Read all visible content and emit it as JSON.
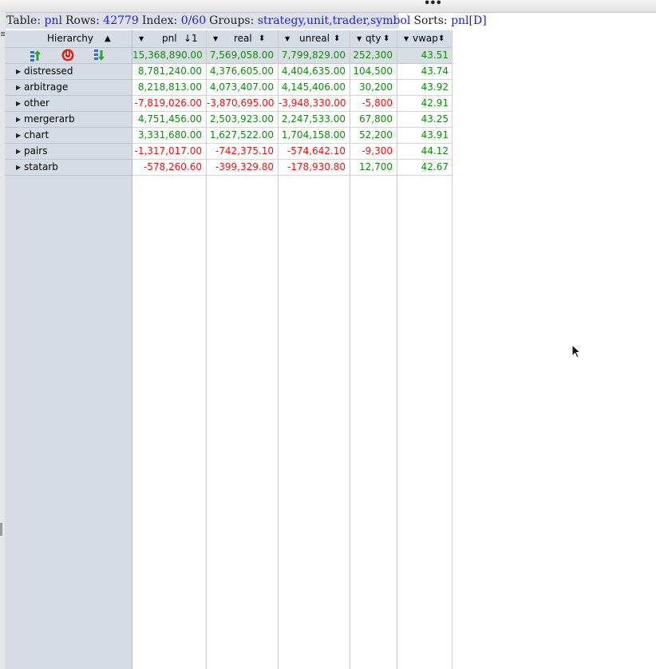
{
  "topbar": {
    "dots": "•••"
  },
  "left_edge": {
    "mark": "≡"
  },
  "info": {
    "table_key": "Table:",
    "table_val": "pnl",
    "rows_key": "Rows:",
    "rows_val": "42779",
    "index_key": "Index:",
    "index_val": "0/60",
    "groups_key": "Groups:",
    "groups_val": "strategy,unit,trader,symbol",
    "sorts_key": "Sorts:",
    "sorts_val": "pnl[D]"
  },
  "columns": {
    "hierarchy": "Hierarchy",
    "pnl": "pnl",
    "pnl_sort": "↓1",
    "real": "real",
    "unreal": "unreal",
    "qty": "qty",
    "vwap": "vwap"
  },
  "icons": {
    "expand": "expand-all-icon",
    "power": "power-icon",
    "collapse": "collapse-all-icon"
  },
  "totals": {
    "pnl": "15,368,890.00",
    "real": "7,569,058.00",
    "unreal": "7,799,829.00",
    "qty": "252,300",
    "vwap": "43.51"
  },
  "rows": [
    {
      "name": "distressed",
      "pnl": "8,781,240.00",
      "real": "4,376,605.00",
      "unreal": "4,404,635.00",
      "qty": "104,500",
      "vwap": "43.74"
    },
    {
      "name": "arbitrage",
      "pnl": "8,218,813.00",
      "real": "4,073,407.00",
      "unreal": "4,145,406.00",
      "qty": "30,200",
      "vwap": "43.92"
    },
    {
      "name": "other",
      "pnl": "-7,819,026.00",
      "real": "-3,870,695.00",
      "unreal": "-3,948,330.00",
      "qty": "-5,800",
      "vwap": "42.91"
    },
    {
      "name": "mergerarb",
      "pnl": "4,751,456.00",
      "real": "2,503,923.00",
      "unreal": "2,247,533.00",
      "qty": "67,800",
      "vwap": "43.25"
    },
    {
      "name": "chart",
      "pnl": "3,331,680.00",
      "real": "1,627,522.00",
      "unreal": "1,704,158.00",
      "qty": "52,200",
      "vwap": "43.91"
    },
    {
      "name": "pairs",
      "pnl": "-1,317,017.00",
      "real": "-742,375.10",
      "unreal": "-574,642.10",
      "qty": "-9,300",
      "vwap": "44.12"
    },
    {
      "name": "statarb",
      "pnl": "-578,260.60",
      "real": "-399,329.80",
      "unreal": "-178,930.80",
      "qty": "12,700",
      "vwap": "42.67"
    }
  ],
  "colors": {
    "positive": "#118811",
    "negative": "#ee1111",
    "info_value": "#2222cc",
    "header_bg": "#d6dce4"
  }
}
